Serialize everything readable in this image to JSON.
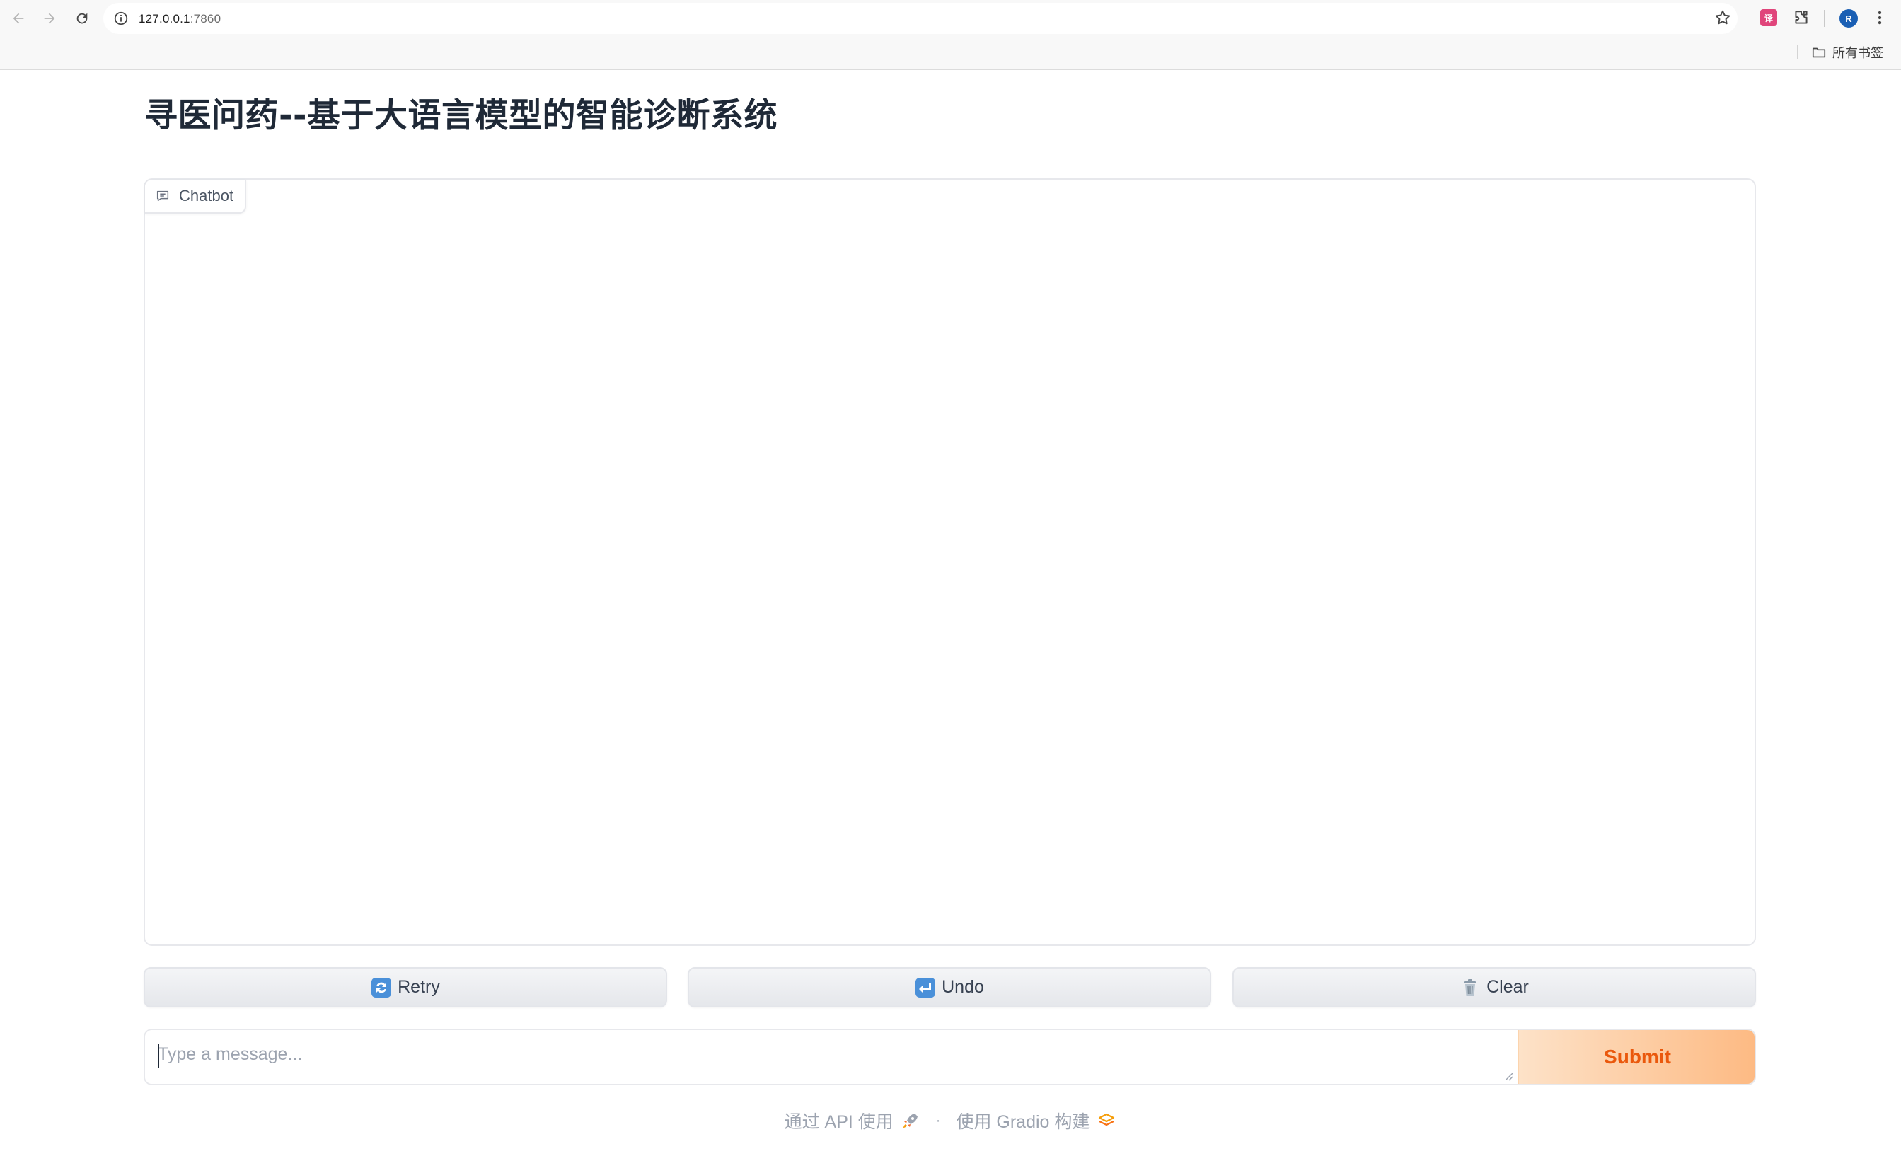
{
  "browser": {
    "url_host": "127.0.0.1",
    "url_port": ":7860",
    "avatar_letter": "R",
    "translate_ext_label": "译",
    "bookmarks_all_label": "所有书签"
  },
  "app": {
    "title": "寻医问药--基于大语言模型的智能诊断系统",
    "chatbot_label": "Chatbot",
    "buttons": {
      "retry": "Retry",
      "undo": "Undo",
      "clear": "Clear"
    },
    "input": {
      "placeholder": "Type a message...",
      "value": ""
    },
    "submit_label": "Submit",
    "footer": {
      "api_label": "通过 API 使用",
      "separator": "·",
      "built_with_label": "使用 Gradio 构建"
    }
  },
  "colors": {
    "accent": "#ea580c",
    "submit_gradient_start": "#fde2c8",
    "submit_gradient_end": "#fdba83",
    "title": "#1f2937",
    "muted": "#9ca3af"
  },
  "icons": {
    "back": "arrow-left-icon",
    "forward": "arrow-right-icon",
    "reload": "reload-icon",
    "site_info": "info-icon",
    "bookmark_star": "star-icon",
    "extensions": "puzzle-icon",
    "menu": "kebab-menu-icon",
    "folder": "folder-icon",
    "chatbot": "chat-bubble-icon",
    "retry": "repeat-arrows-icon",
    "undo": "undo-arrow-icon",
    "clear": "trash-can-icon",
    "api": "rocket-icon",
    "gradio": "gradio-logo-icon"
  }
}
